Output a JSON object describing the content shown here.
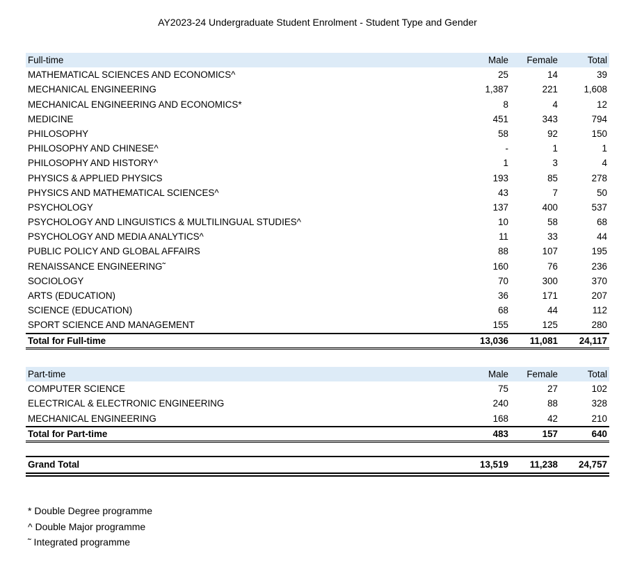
{
  "title": "AY2023-24 Undergraduate Student Enrolment - Student Type and Gender",
  "full_time": {
    "header": {
      "label": "Full-time",
      "male": "Male",
      "female": "Female",
      "total": "Total"
    },
    "rows": [
      {
        "label": "MATHEMATICAL SCIENCES AND ECONOMICS^",
        "male": "25",
        "female": "14",
        "total": "39"
      },
      {
        "label": "MECHANICAL ENGINEERING",
        "male": "1,387",
        "female": "221",
        "total": "1,608"
      },
      {
        "label": "MECHANICAL ENGINEERING AND ECONOMICS*",
        "male": "8",
        "female": "4",
        "total": "12"
      },
      {
        "label": "MEDICINE",
        "male": "451",
        "female": "343",
        "total": "794"
      },
      {
        "label": "PHILOSOPHY",
        "male": "58",
        "female": "92",
        "total": "150"
      },
      {
        "label": "PHILOSOPHY AND CHINESE^",
        "male": "-",
        "female": "1",
        "total": "1"
      },
      {
        "label": "PHILOSOPHY AND HISTORY^",
        "male": "1",
        "female": "3",
        "total": "4"
      },
      {
        "label": "PHYSICS & APPLIED PHYSICS",
        "male": "193",
        "female": "85",
        "total": "278"
      },
      {
        "label": "PHYSICS AND MATHEMATICAL SCIENCES^",
        "male": "43",
        "female": "7",
        "total": "50"
      },
      {
        "label": "PSYCHOLOGY",
        "male": "137",
        "female": "400",
        "total": "537"
      },
      {
        "label": "PSYCHOLOGY AND LINGUISTICS & MULTILINGUAL STUDIES^",
        "male": "10",
        "female": "58",
        "total": "68"
      },
      {
        "label": "PSYCHOLOGY AND MEDIA ANALYTICS^",
        "male": "11",
        "female": "33",
        "total": "44"
      },
      {
        "label": "PUBLIC POLICY AND GLOBAL AFFAIRS",
        "male": "88",
        "female": "107",
        "total": "195"
      },
      {
        "label": "RENAISSANCE ENGINEERING˜",
        "male": "160",
        "female": "76",
        "total": "236"
      },
      {
        "label": "SOCIOLOGY",
        "male": "70",
        "female": "300",
        "total": "370"
      },
      {
        "label": "ARTS (EDUCATION)",
        "male": "36",
        "female": "171",
        "total": "207"
      },
      {
        "label": "SCIENCE (EDUCATION)",
        "male": "68",
        "female": "44",
        "total": "112"
      },
      {
        "label": "SPORT SCIENCE AND MANAGEMENT",
        "male": "155",
        "female": "125",
        "total": "280"
      }
    ],
    "total": {
      "label": "Total for Full-time",
      "male": "13,036",
      "female": "11,081",
      "total": "24,117"
    }
  },
  "part_time": {
    "header": {
      "label": "Part-time",
      "male": "Male",
      "female": "Female",
      "total": "Total"
    },
    "rows": [
      {
        "label": "COMPUTER SCIENCE",
        "male": "75",
        "female": "27",
        "total": "102"
      },
      {
        "label": "ELECTRICAL & ELECTRONIC ENGINEERING",
        "male": "240",
        "female": "88",
        "total": "328"
      },
      {
        "label": "MECHANICAL ENGINEERING",
        "male": "168",
        "female": "42",
        "total": "210"
      }
    ],
    "total": {
      "label": "Total for Part-time",
      "male": "483",
      "female": "157",
      "total": "640"
    }
  },
  "grand_total": {
    "label": "Grand Total",
    "male": "13,519",
    "female": "11,238",
    "total": "24,757"
  },
  "notes": [
    "* Double Degree programme",
    "^ Double Major programme",
    "˜ Integrated programme"
  ],
  "colors": {
    "header_bg": "#ddebf7"
  }
}
